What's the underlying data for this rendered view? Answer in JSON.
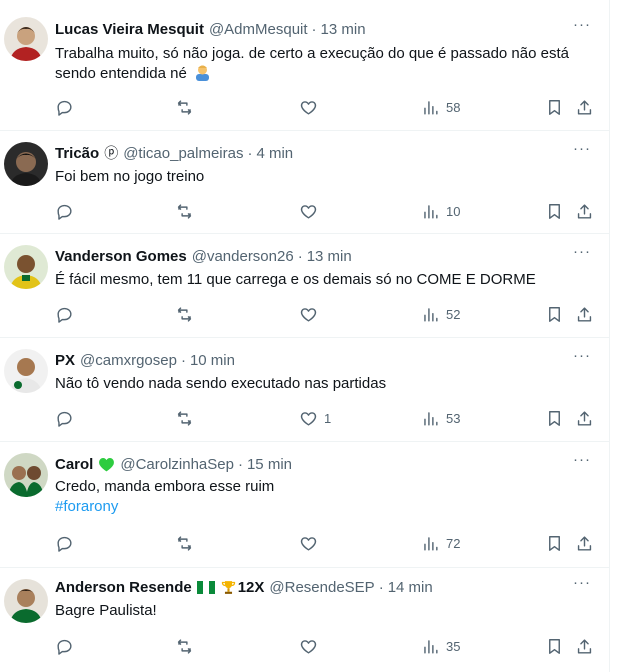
{
  "colors": {
    "text": "#0f1419",
    "muted": "#536471",
    "link": "#1d9bf0",
    "divider": "#eff3f4",
    "heart": "#2ecc40"
  },
  "icons": [
    "reply-icon",
    "retweet-icon",
    "like-icon",
    "views-icon",
    "bookmark-icon",
    "share-icon",
    "more-icon"
  ],
  "tweets": [
    {
      "name": "Lucas Vieira Mesquit",
      "handle": "@AdmMesquit",
      "dot": "·",
      "time": "13 min",
      "text": "Trabalha muito, só não joga. de certo a execução do que é passado não está sendo entendida né",
      "text_emoji": "person-shrugging-emoji",
      "likes": "",
      "views": "58"
    },
    {
      "name": "Tricão",
      "name_badge": "ⓟ",
      "handle": "@ticao_palmeiras",
      "dot": "·",
      "time": "4 min",
      "text": "Foi bem no jogo treino",
      "likes": "",
      "views": "10"
    },
    {
      "name": "Vanderson Gomes",
      "handle": "@vanderson26",
      "dot": "·",
      "time": "13 min",
      "text": "É fácil mesmo, tem 11 que carrega e os demais só no COME E DORME",
      "likes": "",
      "views": "52"
    },
    {
      "name": "PX",
      "handle": "@camxrgosep",
      "dot": "·",
      "time": "10 min",
      "text": "Não tô vendo nada sendo executado nas partidas",
      "likes": "1",
      "views": "53"
    },
    {
      "name": "Carol",
      "name_badge": "green-heart-emoji",
      "handle": "@CarolzinhaSep",
      "dot": "·",
      "time": "15 min",
      "text": "Credo, manda embora esse ruim",
      "hashtag": "#forarony",
      "likes": "",
      "views": "72"
    },
    {
      "name": "Anderson Resende",
      "name_badge": "nigeria-flag-emoji trophy-emoji",
      "name_suffix": "12X",
      "handle": "@ResendeSEP",
      "dot": "·",
      "time": "14 min",
      "text": "Bagre Paulista!",
      "likes": "",
      "views": "35"
    }
  ]
}
